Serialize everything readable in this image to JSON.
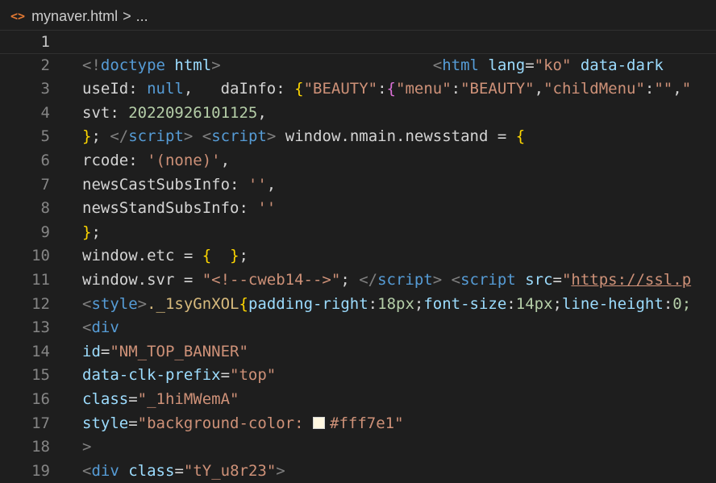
{
  "breadcrumb": {
    "file_icon": "<>",
    "filename": "mynaver.html",
    "separator": ">",
    "more": "..."
  },
  "editor": {
    "current_line": 1,
    "lines": [
      {
        "n": "1",
        "tokens": []
      },
      {
        "n": "2",
        "tokens": [
          {
            "t": "<!",
            "c": "tag"
          },
          {
            "t": "doctype",
            "c": "tname"
          },
          {
            "t": " ",
            "c": "text"
          },
          {
            "t": "html",
            "c": "attr"
          },
          {
            "t": ">",
            "c": "tag"
          },
          {
            "t": "                       ",
            "c": "text"
          },
          {
            "t": "<",
            "c": "tag"
          },
          {
            "t": "html",
            "c": "tname"
          },
          {
            "t": " ",
            "c": "text"
          },
          {
            "t": "lang",
            "c": "attr"
          },
          {
            "t": "=",
            "c": "text"
          },
          {
            "t": "\"ko\"",
            "c": "str"
          },
          {
            "t": " ",
            "c": "text"
          },
          {
            "t": "data-dark",
            "c": "attr"
          }
        ]
      },
      {
        "n": "3",
        "tokens": [
          {
            "t": "useId: ",
            "c": "text"
          },
          {
            "t": "null",
            "c": "kw"
          },
          {
            "t": ",   daInfo: ",
            "c": "text"
          },
          {
            "t": "{",
            "c": "brace1"
          },
          {
            "t": "\"BEAUTY\"",
            "c": "str"
          },
          {
            "t": ":",
            "c": "text"
          },
          {
            "t": "{",
            "c": "brace2"
          },
          {
            "t": "\"menu\"",
            "c": "str"
          },
          {
            "t": ":",
            "c": "text"
          },
          {
            "t": "\"BEAUTY\"",
            "c": "str"
          },
          {
            "t": ",",
            "c": "text"
          },
          {
            "t": "\"childMenu\"",
            "c": "str"
          },
          {
            "t": ":",
            "c": "text"
          },
          {
            "t": "\"\"",
            "c": "str"
          },
          {
            "t": ",",
            "c": "text"
          },
          {
            "t": "\"",
            "c": "str"
          }
        ]
      },
      {
        "n": "4",
        "tokens": [
          {
            "t": "svt: ",
            "c": "text"
          },
          {
            "t": "20220926101125",
            "c": "num"
          },
          {
            "t": ",",
            "c": "text"
          }
        ]
      },
      {
        "n": "5",
        "tokens": [
          {
            "t": "}",
            "c": "brace1"
          },
          {
            "t": "; ",
            "c": "text"
          },
          {
            "t": "</",
            "c": "tag"
          },
          {
            "t": "script",
            "c": "tname"
          },
          {
            "t": ">",
            "c": "tag"
          },
          {
            "t": " ",
            "c": "text"
          },
          {
            "t": "<",
            "c": "tag"
          },
          {
            "t": "script",
            "c": "tname"
          },
          {
            "t": ">",
            "c": "tag"
          },
          {
            "t": " window.nmain.newsstand = ",
            "c": "text"
          },
          {
            "t": "{",
            "c": "brace1"
          }
        ]
      },
      {
        "n": "6",
        "tokens": [
          {
            "t": "rcode: ",
            "c": "text"
          },
          {
            "t": "'(none)'",
            "c": "str"
          },
          {
            "t": ",",
            "c": "text"
          }
        ]
      },
      {
        "n": "7",
        "tokens": [
          {
            "t": "newsCastSubsInfo: ",
            "c": "text"
          },
          {
            "t": "''",
            "c": "str"
          },
          {
            "t": ",",
            "c": "text"
          }
        ]
      },
      {
        "n": "8",
        "tokens": [
          {
            "t": "newsStandSubsInfo: ",
            "c": "text"
          },
          {
            "t": "''",
            "c": "str"
          }
        ]
      },
      {
        "n": "9",
        "tokens": [
          {
            "t": "}",
            "c": "brace1"
          },
          {
            "t": ";",
            "c": "text"
          }
        ]
      },
      {
        "n": "10",
        "tokens": [
          {
            "t": "window.etc = ",
            "c": "text"
          },
          {
            "t": "{",
            "c": "brace1"
          },
          {
            "t": "  ",
            "c": "text"
          },
          {
            "t": "}",
            "c": "brace1"
          },
          {
            "t": ";",
            "c": "text"
          }
        ]
      },
      {
        "n": "11",
        "tokens": [
          {
            "t": "window.svr = ",
            "c": "text"
          },
          {
            "t": "\"<!--cweb14-->\"",
            "c": "str"
          },
          {
            "t": "; ",
            "c": "text"
          },
          {
            "t": "</",
            "c": "tag"
          },
          {
            "t": "script",
            "c": "tname"
          },
          {
            "t": ">",
            "c": "tag"
          },
          {
            "t": " ",
            "c": "text"
          },
          {
            "t": "<",
            "c": "tag"
          },
          {
            "t": "script",
            "c": "tname"
          },
          {
            "t": " ",
            "c": "text"
          },
          {
            "t": "src",
            "c": "attr"
          },
          {
            "t": "=",
            "c": "text"
          },
          {
            "t": "\"",
            "c": "str"
          },
          {
            "t": "https://ssl.p",
            "c": "link"
          }
        ]
      },
      {
        "n": "12",
        "tokens": [
          {
            "t": "<",
            "c": "tag"
          },
          {
            "t": "style",
            "c": "tname"
          },
          {
            "t": ">",
            "c": "tag"
          },
          {
            "t": "._1syGnXOL",
            "c": "cls"
          },
          {
            "t": "{",
            "c": "brace1"
          },
          {
            "t": "padding-right",
            "c": "attr"
          },
          {
            "t": ":",
            "c": "text"
          },
          {
            "t": "18px",
            "c": "num"
          },
          {
            "t": ";",
            "c": "text"
          },
          {
            "t": "font-size",
            "c": "attr"
          },
          {
            "t": ":",
            "c": "text"
          },
          {
            "t": "14px",
            "c": "num"
          },
          {
            "t": ";",
            "c": "text"
          },
          {
            "t": "line-height",
            "c": "attr"
          },
          {
            "t": ":",
            "c": "text"
          },
          {
            "t": "0;",
            "c": "num"
          }
        ]
      },
      {
        "n": "13",
        "tokens": [
          {
            "t": "<",
            "c": "tag"
          },
          {
            "t": "div",
            "c": "tname"
          }
        ]
      },
      {
        "n": "14",
        "tokens": [
          {
            "t": "id",
            "c": "attr"
          },
          {
            "t": "=",
            "c": "text"
          },
          {
            "t": "\"NM_TOP_BANNER\"",
            "c": "str"
          }
        ]
      },
      {
        "n": "15",
        "tokens": [
          {
            "t": "data-clk-prefix",
            "c": "attr"
          },
          {
            "t": "=",
            "c": "text"
          },
          {
            "t": "\"top\"",
            "c": "str"
          }
        ]
      },
      {
        "n": "16",
        "tokens": [
          {
            "t": "class",
            "c": "attr"
          },
          {
            "t": "=",
            "c": "text"
          },
          {
            "t": "\"_1hiMWemA\"",
            "c": "str"
          }
        ]
      },
      {
        "n": "17",
        "tokens": [
          {
            "t": "style",
            "c": "attr"
          },
          {
            "t": "=",
            "c": "text"
          },
          {
            "t": "\"background-color: ",
            "c": "str"
          },
          {
            "t": "",
            "c": "swatch"
          },
          {
            "t": "#fff7e1\"",
            "c": "str"
          }
        ]
      },
      {
        "n": "18",
        "tokens": [
          {
            "t": ">",
            "c": "tag"
          }
        ]
      },
      {
        "n": "19",
        "tokens": [
          {
            "t": "<",
            "c": "tag"
          },
          {
            "t": "div",
            "c": "tname"
          },
          {
            "t": " ",
            "c": "text"
          },
          {
            "t": "class",
            "c": "attr"
          },
          {
            "t": "=",
            "c": "text"
          },
          {
            "t": "\"tY_u8r23\"",
            "c": "str"
          },
          {
            "t": ">",
            "c": "tag"
          }
        ]
      }
    ]
  },
  "colors": {
    "background": "#1e1e1e",
    "swatch": "#fff7e1"
  }
}
